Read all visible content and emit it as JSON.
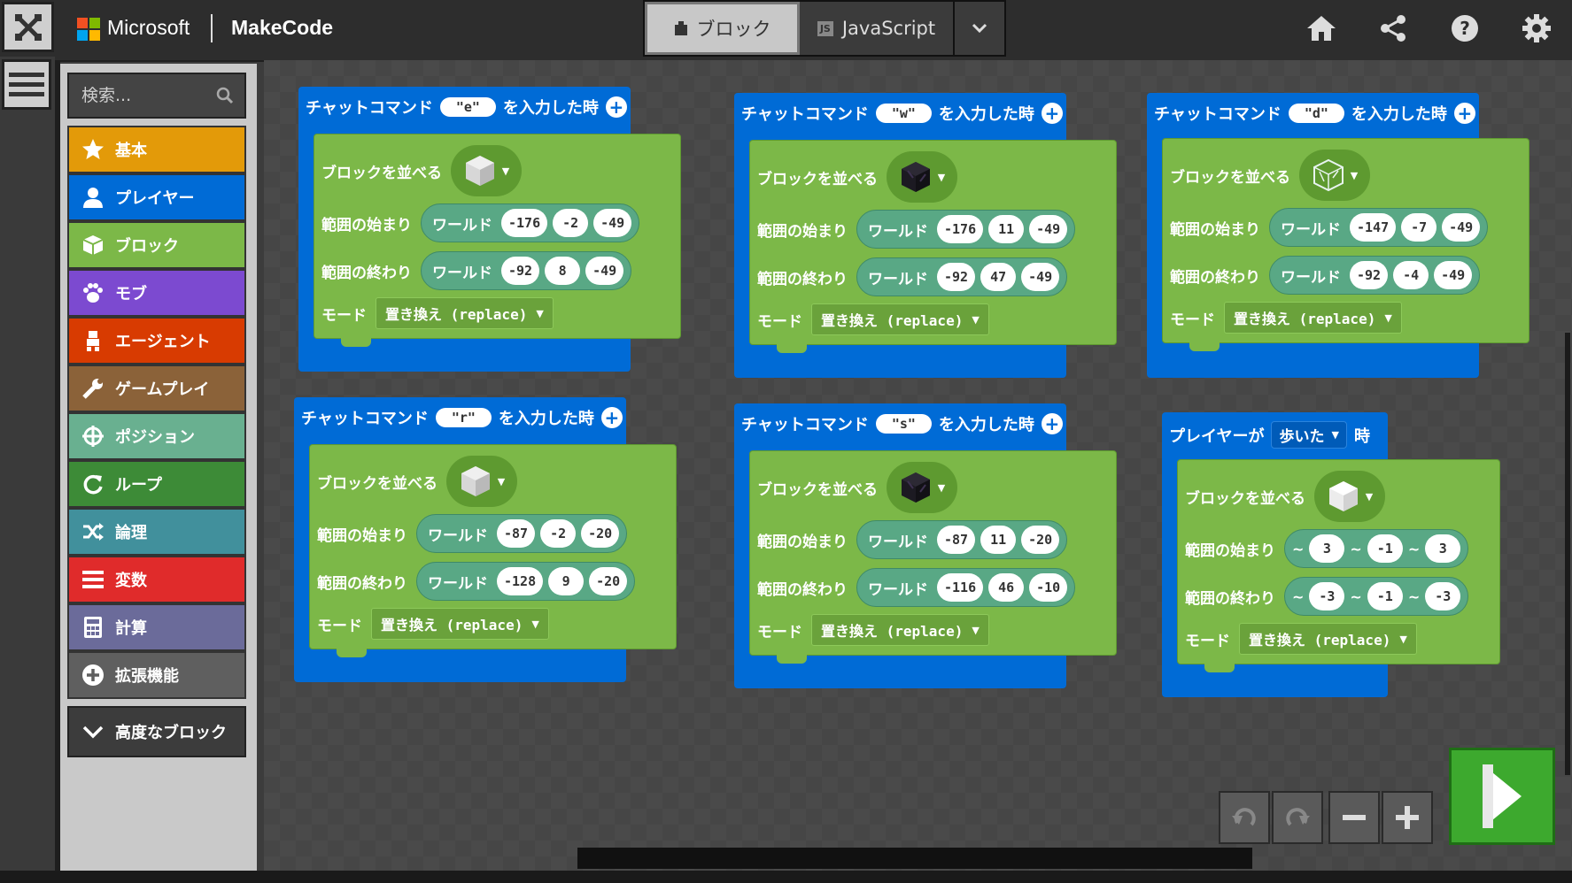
{
  "app": {
    "brand": "Microsoft",
    "product": "MakeCode",
    "tabs": {
      "blocks": "ブロック",
      "javascript": "JavaScript"
    },
    "logo_colors": [
      "#f25022",
      "#7fba00",
      "#00a4ef",
      "#ffb900"
    ]
  },
  "toolbox": {
    "search_placeholder": "検索...",
    "categories": [
      {
        "label": "基本",
        "icon": "star-icon",
        "color": "#e39a09"
      },
      {
        "label": "プレイヤー",
        "icon": "player-icon",
        "color": "#006bd6"
      },
      {
        "label": "ブロック",
        "icon": "cube-icon",
        "color": "#7cb848"
      },
      {
        "label": "モブ",
        "icon": "paw-icon",
        "color": "#7c4ad0"
      },
      {
        "label": "エージェント",
        "icon": "agent-icon",
        "color": "#d83b01"
      },
      {
        "label": "ゲームプレイ",
        "icon": "wrench-icon",
        "color": "#8b6239"
      },
      {
        "label": "ポジション",
        "icon": "crosshair-icon",
        "color": "#69b090"
      },
      {
        "label": "ループ",
        "icon": "loop-icon",
        "color": "#3d8b37"
      },
      {
        "label": "論理",
        "icon": "shuffle-icon",
        "color": "#41909c"
      },
      {
        "label": "変数",
        "icon": "list-icon",
        "color": "#e02b2b"
      },
      {
        "label": "計算",
        "icon": "calculator-icon",
        "color": "#6b6b9a"
      },
      {
        "label": "拡張機能",
        "icon": "plus-circle-icon",
        "color": "#5f5f5f"
      }
    ],
    "advanced": "高度なブロック"
  },
  "labels": {
    "chat_command": "チャットコマンド",
    "when_entered": "を入力した時",
    "fill_blocks": "ブロックを並べる",
    "range_start": "範囲の始まり",
    "range_end": "範囲の終わり",
    "world": "ワールド",
    "mode": "モード",
    "mode_value": "置き換え (replace)",
    "player": "プレイヤーが",
    "walked": "歩いた",
    "time_suffix": "時",
    "tilde": "~"
  },
  "blocks": [
    {
      "command": "\"e\"",
      "block": "iron-block",
      "from": [
        "-176",
        "-2",
        "-49"
      ],
      "to": [
        "-92",
        "8",
        "-49"
      ]
    },
    {
      "command": "\"w\"",
      "block": "obsidian-block",
      "from": [
        "-176",
        "11",
        "-49"
      ],
      "to": [
        "-92",
        "47",
        "-49"
      ]
    },
    {
      "command": "\"d\"",
      "block": "glass-block",
      "from": [
        "-147",
        "-7",
        "-49"
      ],
      "to": [
        "-92",
        "-4",
        "-49"
      ]
    },
    {
      "command": "\"r\"",
      "block": "iron-block",
      "from": [
        "-87",
        "-2",
        "-20"
      ],
      "to": [
        "-128",
        "9",
        "-20"
      ]
    },
    {
      "command": "\"s\"",
      "block": "obsidian-block",
      "from": [
        "-87",
        "11",
        "-20"
      ],
      "to": [
        "-116",
        "46",
        "-10"
      ]
    },
    {
      "block": "white-block",
      "from": [
        "3",
        "-1",
        "3"
      ],
      "to": [
        "-3",
        "-1",
        "-3"
      ]
    }
  ]
}
